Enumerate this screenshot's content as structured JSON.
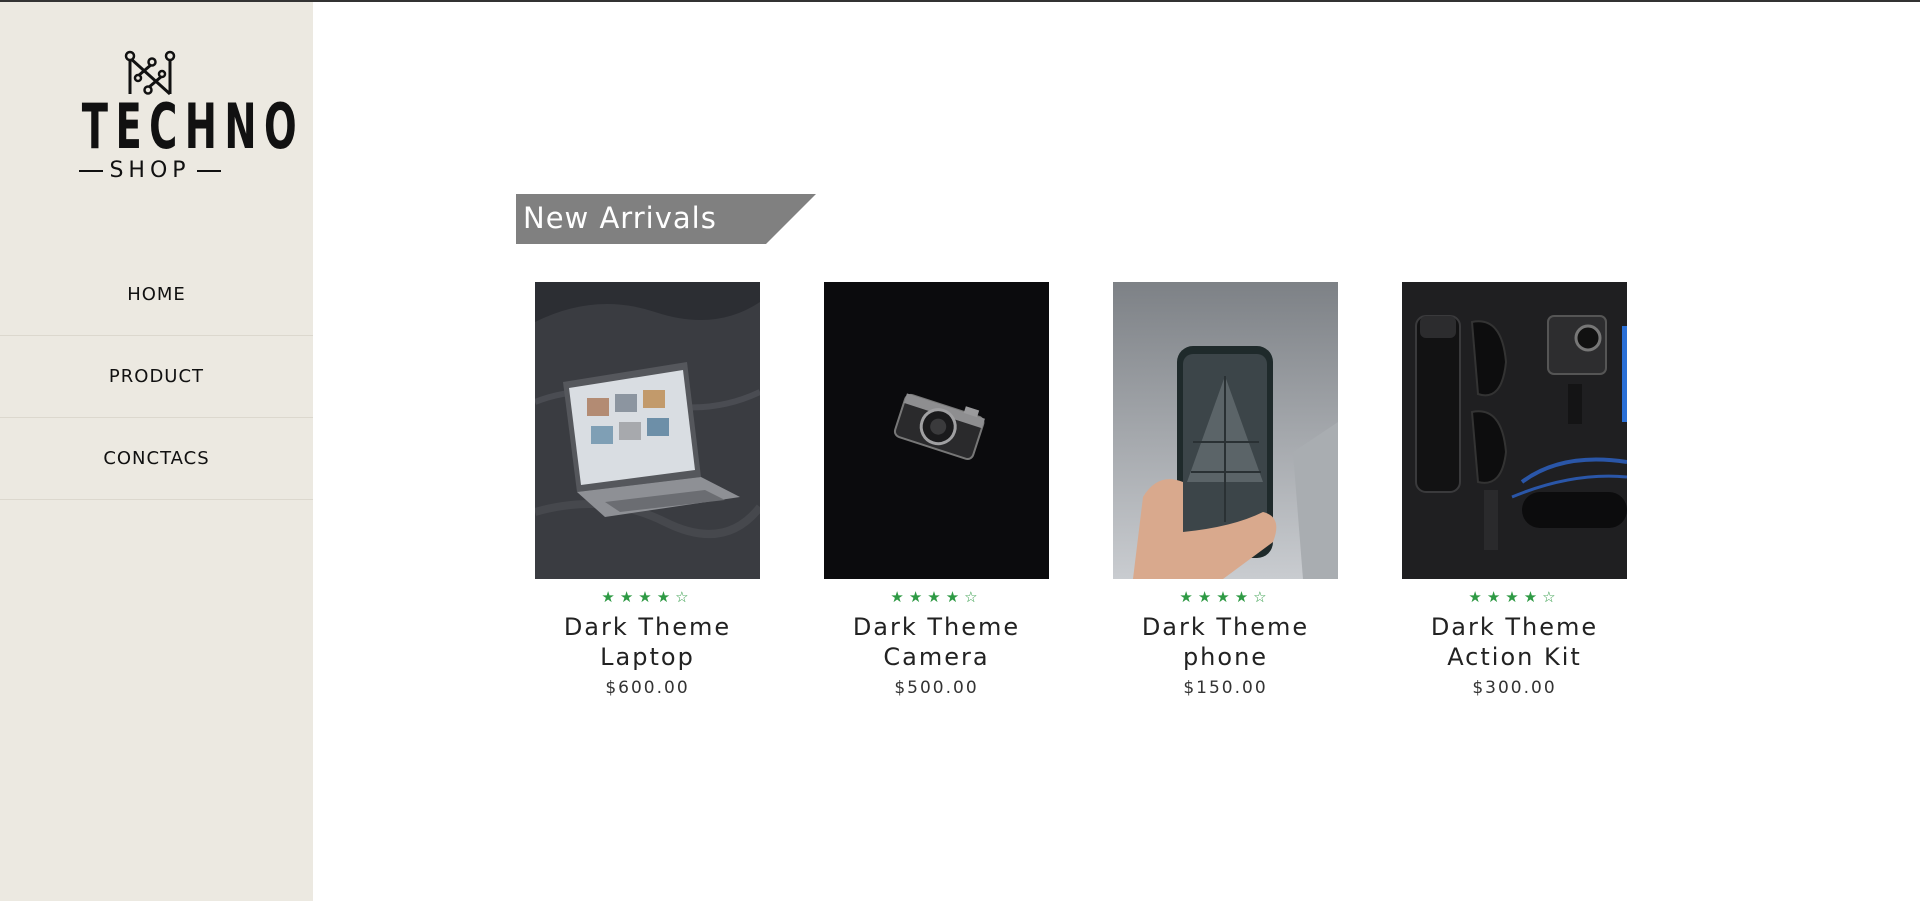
{
  "brand": {
    "name": "TECHNO",
    "sub": "SHOP"
  },
  "nav": {
    "items": [
      {
        "label": "HOME"
      },
      {
        "label": "PRODUCT"
      },
      {
        "label": "CONCTACS"
      }
    ]
  },
  "section": {
    "title": "New Arrivals"
  },
  "products": [
    {
      "name_line1": "Dark Theme",
      "name_line2": "Laptop",
      "price": "$600.00",
      "rating": 4,
      "rating_max": 5,
      "image": "laptop-photo"
    },
    {
      "name_line1": "Dark Theme",
      "name_line2": "Camera",
      "price": "$500.00",
      "rating": 4,
      "rating_max": 5,
      "image": "camera-photo"
    },
    {
      "name_line1": "Dark Theme",
      "name_line2": "phone",
      "price": "$150.00",
      "rating": 4,
      "rating_max": 5,
      "image": "phone-photo"
    },
    {
      "name_line1": "Dark Theme",
      "name_line2": "Action Kit",
      "price": "$300.00",
      "rating": 4,
      "rating_max": 5,
      "image": "action-kit-photo"
    }
  ],
  "colors": {
    "sidebar": "#ece9e1",
    "banner": "#808080",
    "star": "#2e9a44"
  }
}
